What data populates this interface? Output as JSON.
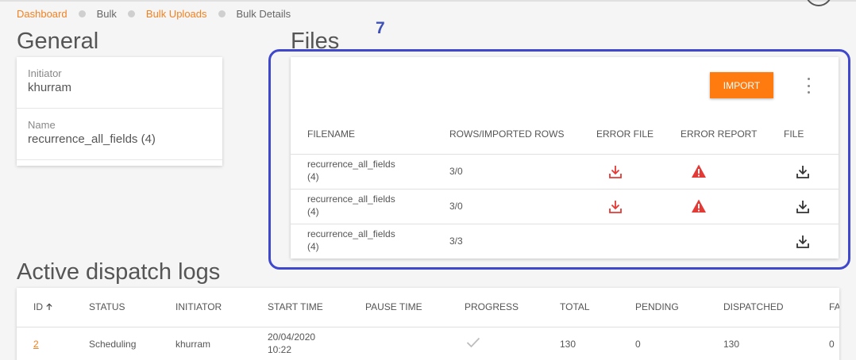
{
  "breadcrumb": [
    {
      "label": "Dashboard",
      "active": true
    },
    {
      "label": "Bulk",
      "active": false
    },
    {
      "label": "Bulk Uploads",
      "active": true
    },
    {
      "label": "Bulk Details",
      "active": false
    }
  ],
  "general": {
    "title": "General",
    "initiator_label": "Initiator",
    "initiator_value": "khurram",
    "name_label": "Name",
    "name_value": "recurrence_all_fields (4)"
  },
  "files": {
    "title": "Files",
    "annotation_number": "7",
    "import_label": "IMPORT",
    "columns": [
      "FILENAME",
      "ROWS/IMPORTED ROWS",
      "ERROR FILE",
      "ERROR REPORT",
      "FILE"
    ],
    "rows": [
      {
        "filename_line1": "recurrence_all_fields",
        "filename_line2": "(4)",
        "rows": "3/0",
        "error_file": true,
        "error_report": true
      },
      {
        "filename_line1": "recurrence_all_fields",
        "filename_line2": "(4)",
        "rows": "3/0",
        "error_file": true,
        "error_report": true
      },
      {
        "filename_line1": "recurrence_all_fields",
        "filename_line2": "(4)",
        "rows": "3/3",
        "error_file": false,
        "error_report": false
      }
    ]
  },
  "active_logs": {
    "title": "Active dispatch logs",
    "columns": [
      "ID",
      "STATUS",
      "INITIATOR",
      "START TIME",
      "PAUSE TIME",
      "PROGRESS",
      "TOTAL",
      "PENDING",
      "DISPATCHED",
      "FA"
    ],
    "sort_icon": "arrow-up-icon",
    "rows": [
      {
        "id": "2",
        "status": "Scheduling",
        "initiator": "khurram",
        "start_date": "20/04/2020",
        "start_time": "10:22",
        "pause_time": "",
        "progress_icon": "check-icon",
        "total": "130",
        "pending": "0",
        "dispatched": "130",
        "fa": "0"
      }
    ]
  },
  "colors": {
    "accent": "#f5801f",
    "import_button": "#ff7b10",
    "error": "#e53935",
    "annotation": "#3f48cc"
  }
}
